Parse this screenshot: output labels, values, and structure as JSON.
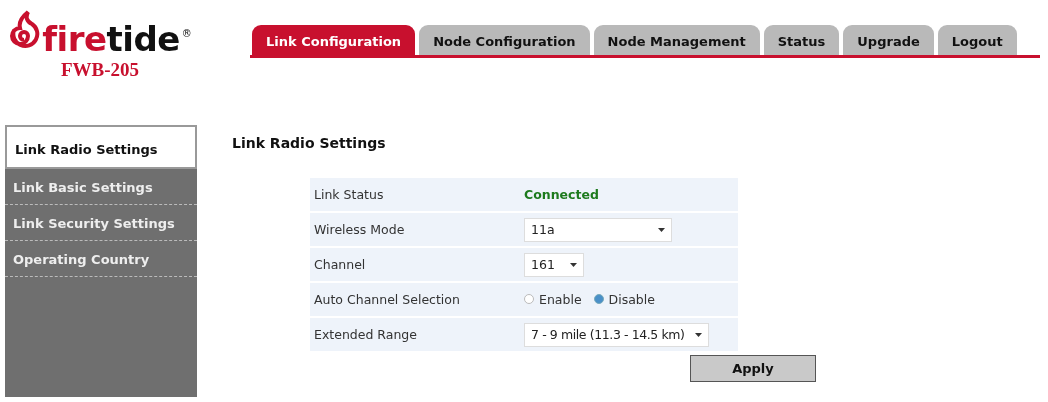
{
  "logo": {
    "wordmark": [
      {
        "text": "fire",
        "kind": "accent"
      },
      {
        "text": "tide",
        "kind": "plain"
      }
    ],
    "registered": "®",
    "model": "FWB-205"
  },
  "tabs": [
    {
      "label": "Link Configuration",
      "selected": true
    },
    {
      "label": "Node Configuration",
      "selected": false
    },
    {
      "label": "Node Management",
      "selected": false
    },
    {
      "label": "Status",
      "selected": false
    },
    {
      "label": "Upgrade",
      "selected": false
    },
    {
      "label": "Logout",
      "selected": false
    }
  ],
  "sidebar": {
    "items": [
      {
        "label": "Link Radio Settings",
        "selected": true
      },
      {
        "label": "Link Basic Settings",
        "selected": false
      },
      {
        "label": "Link Security Settings",
        "selected": false
      },
      {
        "label": "Operating Country",
        "selected": false
      }
    ]
  },
  "heading": "Link Radio Settings",
  "form": {
    "rows": [
      {
        "label": "Link Status",
        "kind": "status",
        "value": "Connected"
      },
      {
        "label": "Wireless Mode",
        "kind": "select",
        "value": "11a"
      },
      {
        "label": "Channel",
        "kind": "select",
        "value": "161"
      },
      {
        "label": "Auto Channel Selection",
        "kind": "radio",
        "options": [
          {
            "label": "Enable",
            "selected": false
          },
          {
            "label": "Disable",
            "selected": true
          }
        ]
      },
      {
        "label": "Extended Range",
        "kind": "select",
        "value": "7 - 9 mile (11.3 - 14.5 km)"
      }
    ],
    "button": "Apply"
  }
}
